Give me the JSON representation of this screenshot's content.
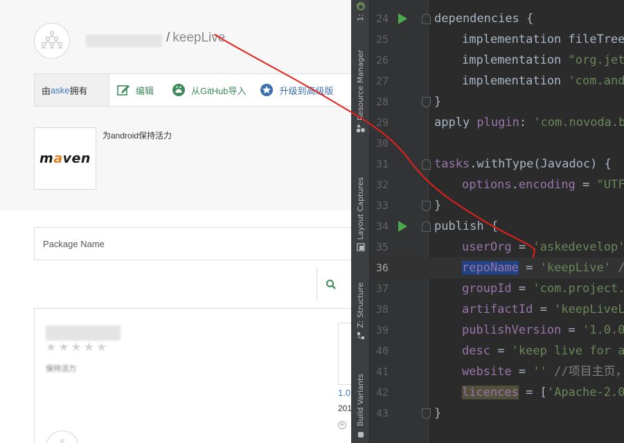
{
  "web": {
    "repo_name": "keepLive",
    "repo_sep": "/",
    "toolbar": {
      "owner_prefix": "由",
      "owner_name": "aske",
      "owner_suffix": "拥有",
      "edit_label": "编辑",
      "github_import_label": "从GitHub导入",
      "upgrade_label": "升级到高级版"
    },
    "maven_logo": "maven",
    "package_description": "为android保持活力",
    "package_name_placeholder": "Package Name",
    "result": {
      "rating_stars": 5,
      "rating_value": 0,
      "version": "1.0",
      "date": "201",
      "blurred_text": "保持活力"
    }
  },
  "tool_strip": {
    "tabs": [
      "1:",
      "Resource Manager",
      "Layout Captures",
      "Z: Structure",
      "Build Variants"
    ]
  },
  "editor": {
    "lines": [
      {
        "num": "24"
      },
      {
        "num": "25"
      },
      {
        "num": "26"
      },
      {
        "num": "27"
      },
      {
        "num": "28"
      },
      {
        "num": "29"
      },
      {
        "num": "30"
      },
      {
        "num": "31"
      },
      {
        "num": "32"
      },
      {
        "num": "33"
      },
      {
        "num": "34"
      },
      {
        "num": "35"
      },
      {
        "num": "36"
      },
      {
        "num": "37"
      },
      {
        "num": "38"
      },
      {
        "num": "39"
      },
      {
        "num": "40"
      },
      {
        "num": "41"
      },
      {
        "num": "42"
      },
      {
        "num": "43"
      }
    ],
    "code": {
      "l24": "dependencies {",
      "l25": "implementation fileTree",
      "l26a": "implementation ",
      "l26b": "\"org.jetb",
      "l27a": "implementation ",
      "l27b": "'com.andr",
      "l28": "}",
      "l29a": "apply ",
      "l29b": "plugin",
      "l29c": ": ",
      "l29d": "'com.novoda.bi",
      "l31a": "tasks",
      "l31b": ".withType(Javadoc) {",
      "l32a": "options",
      "l32b": ".",
      "l32c": "encoding",
      "l32d": " = ",
      "l32e": "\"UTF-",
      "l33": "}",
      "l34": "publish {",
      "l35a": "userOrg",
      "l35b": " = ",
      "l35c": "'askedevelop'",
      "l36a": "repoName",
      "l36b": " = ",
      "l36c": "'keepLive'",
      "l36d": " //",
      "l37a": "groupId",
      "l37b": " = ",
      "l37c": "'com.project.k",
      "l38a": "artifactId",
      "l38b": " = ",
      "l38c": "'keepLiveLi",
      "l39a": "publishVersion",
      "l39b": " = ",
      "l39c": "'1.0.0'",
      "l40a": "desc",
      "l40b": " = ",
      "l40c": "'keep live for ar",
      "l41a": "website",
      "l41b": " = ",
      "l41c": "''",
      "l41d": " //项目主页，",
      "l42a": "licences",
      "l42b": " = [",
      "l42c": "'Apache-2.0'",
      "l43": "}"
    }
  },
  "colors": {
    "annotation": "#e8201a",
    "run_arrow": "#4aa84d",
    "string": "#6a8759",
    "property": "#9876aa",
    "selection": "#214283"
  }
}
